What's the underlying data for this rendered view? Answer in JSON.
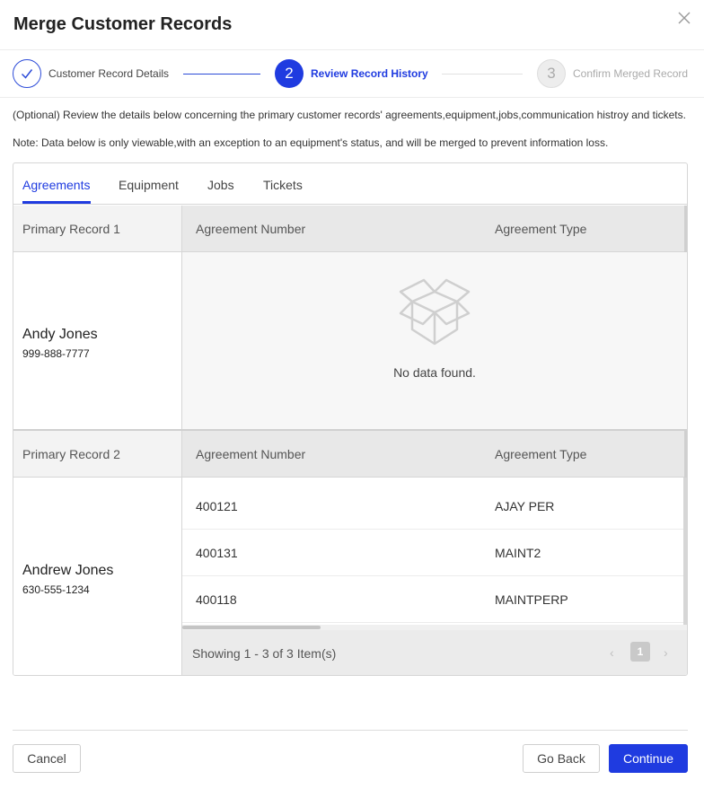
{
  "dialog": {
    "title": "Merge Customer Records"
  },
  "steps": [
    {
      "number": "",
      "label": "Customer Record Details",
      "state": "complete"
    },
    {
      "number": "2",
      "label": "Review Record History",
      "state": "active"
    },
    {
      "number": "3",
      "label": "Confirm Merged Record",
      "state": "pending"
    }
  ],
  "notes": {
    "optional": "(Optional) Review the details below concerning the primary customer records' agreements,equipment,jobs,communication histroy and tickets.",
    "viewable": "Note: Data below is only viewable,with an exception to an equipment's status, and will be merged to prevent information loss."
  },
  "tabs": [
    {
      "label": "Agreements"
    },
    {
      "label": "Equipment"
    },
    {
      "label": "Jobs"
    },
    {
      "label": "Tickets"
    }
  ],
  "records": [
    {
      "header": "Primary Record 1",
      "name": "Andy Jones",
      "phone": "999-888-7777",
      "columns": [
        "Agreement Number",
        "Agreement Type"
      ],
      "empty_text": "No data found.",
      "rows": []
    },
    {
      "header": "Primary Record 2",
      "name": "Andrew Jones",
      "phone": "630-555-1234",
      "columns": [
        "Agreement Number",
        "Agreement Type"
      ],
      "rows": [
        {
          "number": "400121",
          "type": "AJAY PER"
        },
        {
          "number": "400131",
          "type": "MAINT2"
        },
        {
          "number": "400118",
          "type": "MAINTPERP"
        }
      ]
    }
  ],
  "pagination": {
    "showing": "Showing 1 - 3 of 3 Item(s)",
    "prev": "‹",
    "page": "1",
    "next": "›"
  },
  "buttons": {
    "cancel": "Cancel",
    "back": "Go Back",
    "continue": "Continue"
  },
  "colors": {
    "accent": "#1f3be0",
    "header_bg": "#e8e8e8",
    "empty_bg": "#f7f7f7"
  },
  "icons": {
    "close": "close-icon",
    "check": "check-icon",
    "empty": "empty-box-icon"
  }
}
